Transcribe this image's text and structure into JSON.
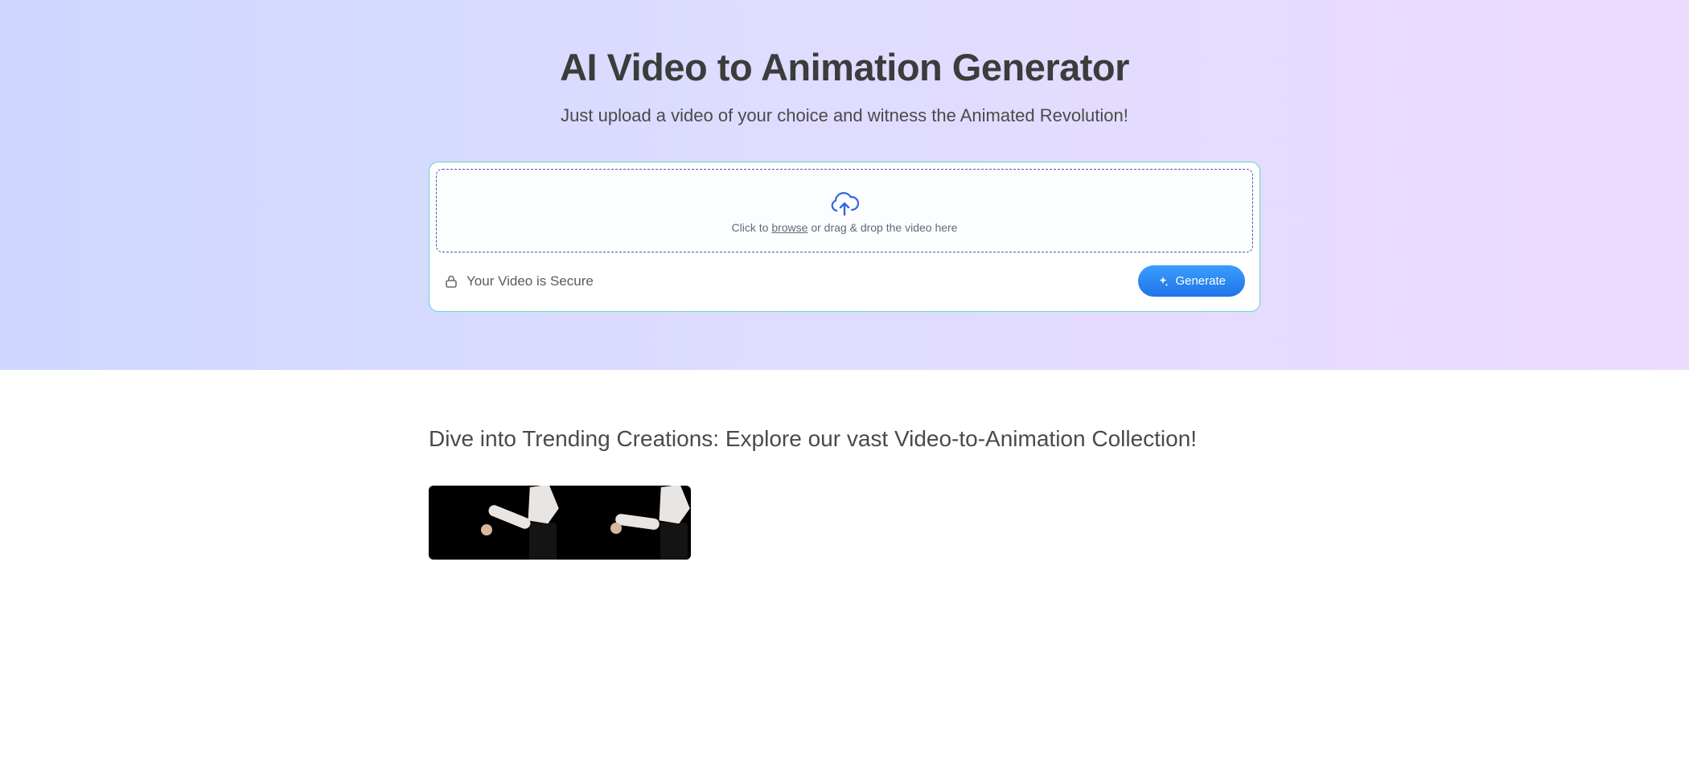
{
  "hero": {
    "title": "AI Video to Animation Generator",
    "subtitle": "Just upload a video of your choice and witness the Animated Revolution!"
  },
  "upload": {
    "prefix": "Click to ",
    "browse": "browse",
    "suffix": " or drag & drop the video here",
    "secure_label": "Your Video is Secure",
    "generate_label": "Generate"
  },
  "gallery": {
    "title": "Dive into Trending Creations: Explore our vast Video-to-Animation Collection!"
  }
}
